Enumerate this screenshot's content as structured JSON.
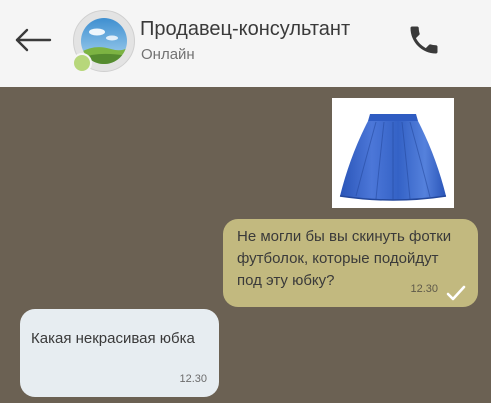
{
  "header": {
    "contact_name": "Продавец-консультант",
    "status": "Онлайн",
    "colors": {
      "background": "#f5f5f5",
      "online_indicator": "#b7d77b"
    }
  },
  "icons": {
    "back": "arrow-left-icon",
    "call": "phone-icon",
    "read": "checkmark-icon"
  },
  "chat": {
    "background": "#6b6153",
    "messages": [
      {
        "direction": "outgoing",
        "type": "image",
        "image_subject": "blue-skirt"
      },
      {
        "direction": "outgoing",
        "type": "text",
        "text": "Не могли бы вы скинуть фотки футболок, которые подойдут под эту юбку?",
        "time": "12.30",
        "read": true,
        "bubble_color": "#c2b97f"
      },
      {
        "direction": "incoming",
        "type": "text",
        "text": "Какая некрасивая юбка",
        "time": "12.30",
        "bubble_color": "#e7edf1"
      }
    ]
  }
}
